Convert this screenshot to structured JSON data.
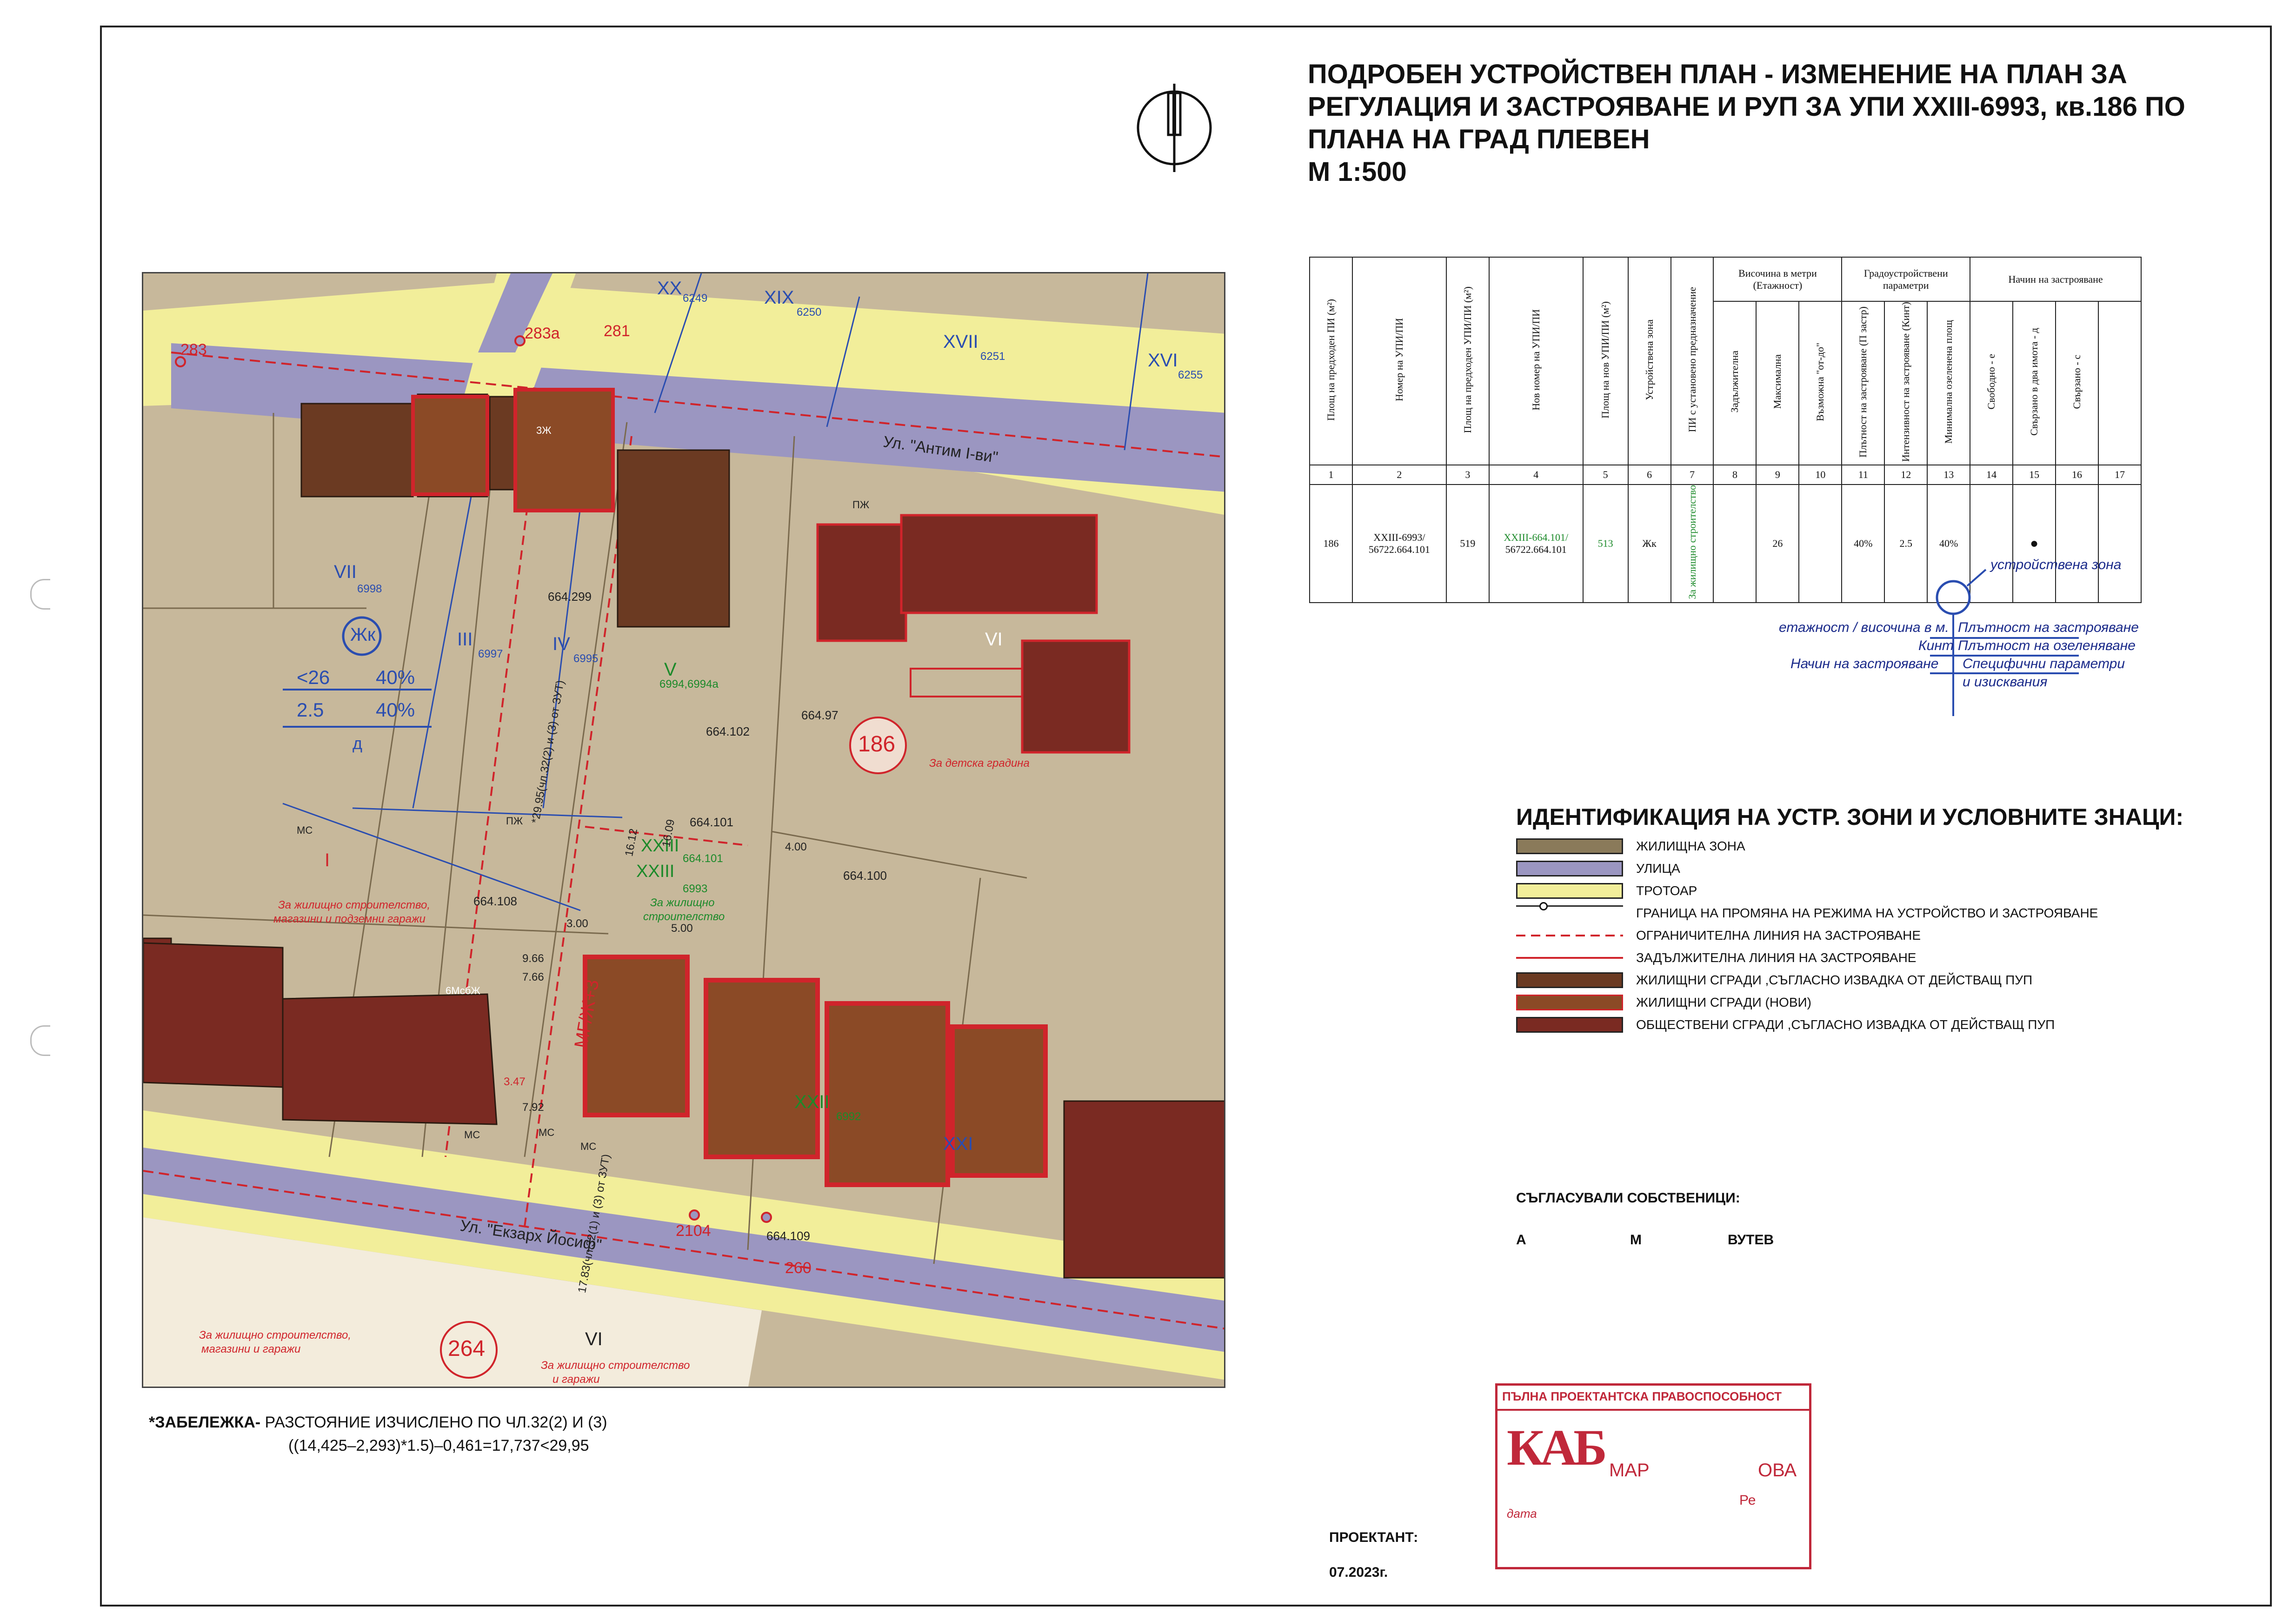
{
  "title": {
    "line1": "ПОДРОБЕН УСТРОЙСТВЕН ПЛАН - ИЗМЕНЕНИЕ НА ПЛАН ЗА",
    "line2": "РЕГУЛАЦИЯ И ЗАСТРОЯВАНЕ И РУП ЗА УПИ XXIII-6993, кв.186 ПО",
    "line3": "ПЛАНА НА ГРАД ПЛЕВЕН",
    "scale": "М 1:500"
  },
  "colors": {
    "residential_zone": "#8a7a5a",
    "street": "#9b96c1",
    "sidewalk": "#f2ee9a",
    "existing_buildings": "#6b3a22",
    "new_buildings": "#8b4a26",
    "public_buildings": "#7a2a22",
    "boundary_red": "#d0242b",
    "plot_blue": "#2a4db0"
  },
  "table": {
    "group_headers": {
      "height": "Височина в метри (Етажност)",
      "params": "Градоустройствени параметри",
      "method": "Начин на застрояване"
    },
    "headers": [
      "Площ на предходен ПИ (м²)",
      "Номер на УПИ/ПИ",
      "Площ на предходен УПИ/ПИ (м²)",
      "Нов номер на УПИ/ПИ",
      "Площ на нов УПИ/ПИ (м²)",
      "Устройствена зона",
      "ПИ с установено предназначение",
      "Задължителна",
      "Максимална",
      "Възможна \"от-до\"",
      "Плътност на застрояване (П застр)",
      "Интензивност на застрояване (Кинт)",
      "Минимална озеленена площ",
      "Свободно - е",
      "Свързано в два имота - д",
      "Свързано - с",
      ""
    ],
    "numbers": [
      "1",
      "2",
      "3",
      "4",
      "5",
      "6",
      "7",
      "8",
      "9",
      "10",
      "11",
      "12",
      "13",
      "14",
      "15",
      "16",
      "17"
    ],
    "row": {
      "c1": "186",
      "c2a": "XXIII-6993/",
      "c2b": "56722.664.101",
      "c3": "519",
      "c4a": "XXIII-664.101/",
      "c4b": "56722.664.101",
      "c5": "513",
      "c6": "Жк",
      "c7": "За жилищно строителство",
      "c8": "",
      "c9": "26",
      "c10": "",
      "c11": "40%",
      "c12": "2.5",
      "c13": "40%",
      "c14": "",
      "c15": "●",
      "c16": "",
      "c17": ""
    }
  },
  "key": {
    "zone": "устройствена зона",
    "floors": "етажност / височина в м.",
    "density": "Плътност на застрояване",
    "kint": "Кинт",
    "green": "Плътност на озеленяване",
    "method": "Начин на застрояване",
    "specific": "Специфични параметри",
    "req": "и изисквания"
  },
  "legend": {
    "title": "ИДЕНТИФИКАЦИЯ НА УСТР. ЗОНИ И УСЛОВНИТЕ ЗНАЦИ:",
    "items": [
      "ЖИЛИЩНА ЗОНА",
      "УЛИЦА",
      "ТРОТОАР",
      "ГРАНИЦА НА ПРОМЯНА НА РЕЖИМА НА УСТРОЙСТВО И ЗАСТРОЯВАНЕ",
      "ОГРАНИЧИТЕЛНА ЛИНИЯ НА ЗАСТРОЯВАНЕ",
      "ЗАДЪЛЖИТЕЛНА ЛИНИЯ НА ЗАСТРОЯВАНЕ",
      "ЖИЛИЩНИ СГРАДИ ,СЪГЛАСНО ИЗВАДКА ОТ ДЕЙСТВАЩ ПУП",
      "ЖИЛИЩНИ СГРАДИ (НОВИ)",
      "ОБЩЕСТВЕНИ СГРАДИ ,СЪГЛАСНО ИЗВАДКА ОТ ДЕЙСТВАЩ ПУП"
    ]
  },
  "map": {
    "streets": {
      "top": "Ул. \"Антим I-ви\"",
      "bottom": "Ул. \"Екзарх Йосиф\""
    },
    "points": [
      "283",
      "283а",
      "281",
      "2104",
      "260"
    ],
    "blocks": {
      "main": "186",
      "south": "264"
    },
    "plots": [
      "XX",
      "6249",
      "XIX",
      "6250",
      "XVII",
      "6251",
      "XVI",
      "6255",
      "VII",
      "6998",
      "III",
      "6997",
      "IV",
      "6995",
      "V",
      "6994,6994а",
      "VI",
      "XXIII",
      "XXIII",
      "664.101",
      "6993",
      "XXII",
      "6992",
      "XXI",
      "I",
      "VI"
    ],
    "parcels": [
      "664.299",
      "664.102",
      "664.97",
      "664.101",
      "664.100",
      "664.108",
      "664.109"
    ],
    "zone_box": {
      "zone": "Жк",
      "h": "<26",
      "p": "40%",
      "k": "2.5",
      "g": "40%",
      "m": "д"
    },
    "labels": {
      "kindergarten": "За детска градина",
      "res_left": "За жилищно строителство,",
      "res_left2": "магазини и подземни гаражи",
      "res_mid": "За жилищно",
      "res_mid2": "строителство",
      "res_bl": "За жилищно строителство,",
      "res_bl2": "магазини и гаражи",
      "res_bm": "За жилищно строителство",
      "res_bm2": "и гаражи",
      "mgzh": "МГ/Ж+3",
      "pzh": "ПЖ",
      "ms": "МС",
      "mc6": "6МсбЖ",
      "vzh": "3Ж"
    },
    "dims": [
      "3.00",
      "5.00",
      "9.66",
      "7.66",
      "3.47",
      "7.92",
      "16.12",
      "16.09",
      "*29.95(чл.32(2) и (3) от ЗУТ)",
      "17.83(чл.32(1) и (3) от ЗУТ)",
      "4.00"
    ]
  },
  "note": {
    "label": "*ЗАБЕЛЕЖКА-",
    "text": "РАЗСТОЯНИЕ ИЗЧИСЛЕНО ПО ЧЛ.32(2) И (3)",
    "formula": "((14,425–2,293)*1.5)–0,461=17,737<29,95"
  },
  "signatures": {
    "agreed": "СЪГЛАСУВАЛИ СОБСТВЕНИЦИ:",
    "names": [
      "А",
      "М",
      "ВУТЕВ"
    ],
    "designer": "ПРОЕКТАНТ:",
    "date": "07.2023г."
  },
  "stamp": {
    "top": "ПЪЛНА ПРОЕКТАНТСКА ПРАВОСПОСОБНОСТ",
    "logo": "КАБ",
    "name1": "МАР",
    "name2": "ОВА",
    "reg": "Ре",
    "date": "дата"
  }
}
